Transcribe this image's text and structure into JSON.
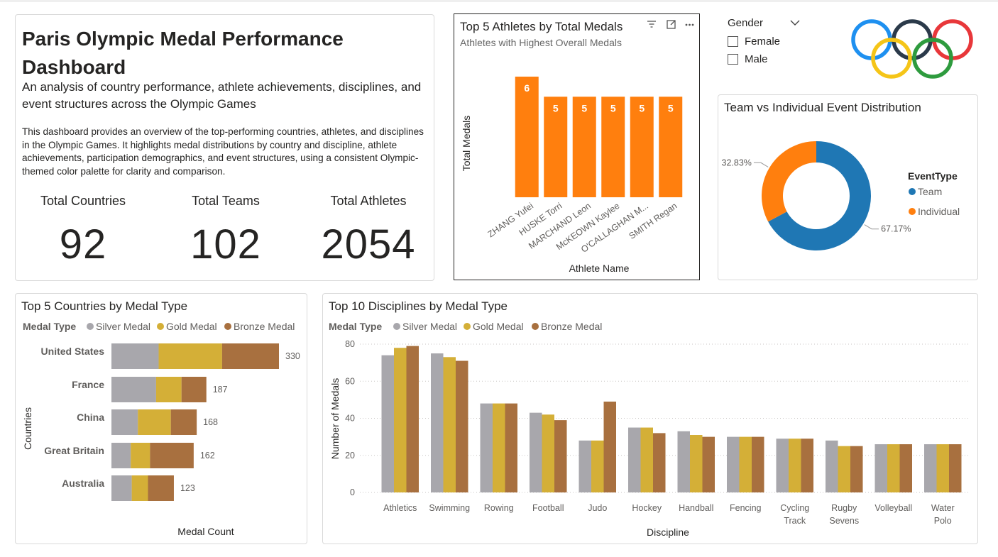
{
  "header": {
    "title": "Paris Olympic Medal Performance Dashboard",
    "subtitle": "An analysis of country performance, athlete achievements, disciplines, and event structures across the Olympic Games",
    "description": "This dashboard provides an overview of the top-performing countries, athletes, and disciplines in the Olympic Games. It highlights medal distributions by country and discipline, athlete achievements, participation demographics, and event structures, using a consistent Olympic-themed color palette for clarity and comparison."
  },
  "kpis": [
    {
      "label": "Total Countries",
      "value": "92"
    },
    {
      "label": "Total Teams",
      "value": "102"
    },
    {
      "label": "Total Athletes",
      "value": "2054"
    }
  ],
  "slicer": {
    "title": "Gender",
    "options": [
      "Female",
      "Male"
    ]
  },
  "colors": {
    "silver": "#A8A7AC",
    "gold": "#D4AF37",
    "bronze": "#A8703F",
    "orange": "#FF7F0E",
    "team": "#1F77B4",
    "individual": "#FF7F0E",
    "rings": [
      "#1E90F0",
      "#F5C518",
      "#2B3A4A",
      "#2E9B3E",
      "#E8373A"
    ]
  },
  "chart_data": [
    {
      "id": "athletes",
      "type": "bar",
      "title": "Top 5 Athletes by Total Medals",
      "subtitle": "Athletes with Highest Overall Medals",
      "xlabel": "Athlete Name",
      "ylabel": "Total Medals",
      "categories": [
        "ZHANG Yufei",
        "HUSKE Torri",
        "MARCHAND Leon",
        "McKEOWN Kaylee",
        "O'CALLAGHAN M...",
        "SMITH Regan"
      ],
      "values": [
        6,
        5,
        5,
        5,
        5,
        5
      ],
      "color": "#FF7F0E"
    },
    {
      "id": "eventtype",
      "type": "pie",
      "title": "Team vs Individual Event Distribution",
      "legend_title": "EventType",
      "labels": [
        "Team",
        "Individual"
      ],
      "values": [
        67.17,
        32.83
      ],
      "value_labels": [
        "67.17%",
        "32.83%"
      ],
      "colors": [
        "#1F77B4",
        "#FF7F0E"
      ]
    },
    {
      "id": "countries",
      "type": "bar",
      "orientation": "horizontal-stacked",
      "title": "Top 5 Countries by Medal Type",
      "legend_title": "Medal Type",
      "xlabel": "Medal Count",
      "ylabel": "Countries",
      "categories": [
        "United States",
        "France",
        "China",
        "Great Britain",
        "Australia"
      ],
      "series": [
        {
          "name": "Silver Medal",
          "values": [
            93,
            88,
            52,
            38,
            40
          ],
          "color": "#A8A7AC"
        },
        {
          "name": "Gold Medal",
          "values": [
            125,
            50,
            65,
            38,
            32
          ],
          "color": "#D4AF37"
        },
        {
          "name": "Bronze Medal",
          "values": [
            112,
            49,
            51,
            86,
            51
          ],
          "color": "#A8703F"
        }
      ],
      "totals": [
        330,
        187,
        168,
        162,
        123
      ],
      "xlim": [
        0,
        330
      ]
    },
    {
      "id": "disciplines",
      "type": "bar",
      "title": "Top 10 Disciplines by Medal Type",
      "legend_title": "Medal Type",
      "xlabel": "Discipline",
      "ylabel": "Number of Medals",
      "categories": [
        "Athletics",
        "Swimming",
        "Rowing",
        "Football",
        "Judo",
        "Hockey",
        "Handball",
        "Fencing",
        "Cycling Track",
        "Rugby Sevens",
        "Volleyball",
        "Water Polo"
      ],
      "series": [
        {
          "name": "Silver Medal",
          "values": [
            74,
            75,
            48,
            43,
            28,
            35,
            33,
            30,
            29,
            28,
            26,
            26
          ],
          "color": "#A8A7AC"
        },
        {
          "name": "Gold Medal",
          "values": [
            78,
            73,
            48,
            42,
            28,
            35,
            31,
            30,
            29,
            25,
            26,
            26
          ],
          "color": "#D4AF37"
        },
        {
          "name": "Bronze Medal",
          "values": [
            79,
            71,
            48,
            39,
            49,
            32,
            30,
            30,
            29,
            25,
            26,
            26
          ],
          "color": "#A8703F"
        }
      ],
      "ylim": [
        0,
        80
      ],
      "yticks": [
        0,
        20,
        40,
        60,
        80
      ],
      "grid": true
    }
  ]
}
